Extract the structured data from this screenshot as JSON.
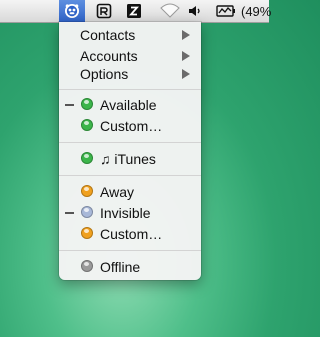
{
  "menubar": {
    "battery_percent": "(49%",
    "icons": [
      "adium-duck-icon",
      "r-app-icon",
      "z-app-icon",
      "wifi-icon",
      "volume-icon",
      "battery-icon"
    ]
  },
  "menu": {
    "submenus": [
      {
        "label": "Contacts"
      },
      {
        "label": "Accounts"
      },
      {
        "label": "Options"
      }
    ],
    "available": [
      {
        "label": "Available",
        "status_color": "#3bb54a",
        "current": true
      },
      {
        "label": "Custom…",
        "status_color": "#3bb54a",
        "current": false
      }
    ],
    "itunes": {
      "label": "iTunes",
      "note_icon": "♫",
      "status_color": "#3bb54a"
    },
    "away": [
      {
        "label": "Away",
        "status_color": "#f0a01e",
        "current": false
      },
      {
        "label": "Invisible",
        "status_color": "#a8b8d8",
        "current": true
      },
      {
        "label": "Custom…",
        "status_color": "#f0a01e",
        "current": false
      }
    ],
    "offline": {
      "label": "Offline",
      "status_color": "#9a9a9a"
    }
  }
}
